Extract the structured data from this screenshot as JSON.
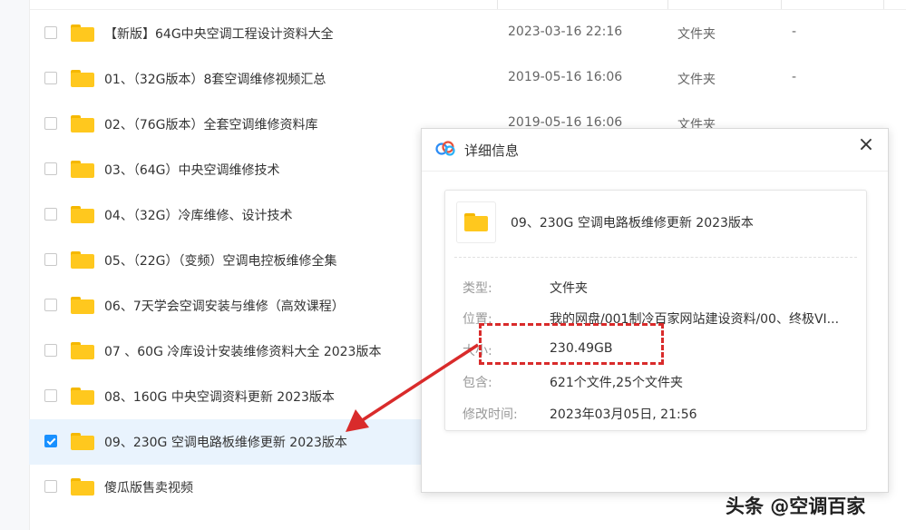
{
  "files": [
    {
      "name": "【新版】64G中央空调工程设计资料大全",
      "date": "2023-03-16 22:16",
      "type": "文件夹",
      "size": "-",
      "checked": false
    },
    {
      "name": "01、（32G版本）8套空调维修视频汇总",
      "date": "2019-05-16 16:06",
      "type": "文件夹",
      "size": "-",
      "checked": false
    },
    {
      "name": "02、（76G版本）全套空调维修资料库",
      "date": "2019-05-16 16:06",
      "type": "文件夹",
      "size": "",
      "checked": false
    },
    {
      "name": "03、（64G）中央空调维修技术",
      "date": "",
      "type": "",
      "size": "",
      "checked": false
    },
    {
      "name": "04、（32G）冷库维修、设计技术",
      "date": "",
      "type": "",
      "size": "",
      "checked": false
    },
    {
      "name": "05、（22G）（变频）空调电控板维修全集",
      "date": "",
      "type": "",
      "size": "",
      "checked": false
    },
    {
      "name": "06、7天学会空调安装与维修（高效课程）",
      "date": "",
      "type": "",
      "size": "",
      "checked": false
    },
    {
      "name": "07 、60G 冷库设计安装维修资料大全 2023版本",
      "date": "",
      "type": "",
      "size": "",
      "checked": false
    },
    {
      "name": "08、160G 中央空调资料更新 2023版本",
      "date": "",
      "type": "",
      "size": "",
      "checked": false
    },
    {
      "name": "09、230G 空调电路板维修更新  2023版本",
      "date": "",
      "type": "",
      "size": "",
      "checked": true
    },
    {
      "name": "傻瓜版售卖视频",
      "date": "",
      "type": "",
      "size": "",
      "checked": false
    }
  ],
  "dialog": {
    "title": "详细信息",
    "close_label": "×",
    "file_name": "09、230G 空调电路板维修更新  2023版本",
    "type_label": "类型:",
    "type_value": "文件夹",
    "location_label": "位置:",
    "location_value": "我的网盘/001制冷百家网站建设资料/00、终极VI...",
    "size_label": "大小:",
    "size_value": "230.49GB",
    "contains_label": "包含:",
    "contains_value": "621个文件,25个文件夹",
    "modified_label": "修改时间:",
    "modified_value": "2023年03月05日, 21:56"
  },
  "watermark": "头条 @空调百家",
  "colors": {
    "accent": "#1890ff",
    "folder": "#ffc81e",
    "selected_row": "#e9f3fd",
    "highlight": "#d92b2b"
  }
}
